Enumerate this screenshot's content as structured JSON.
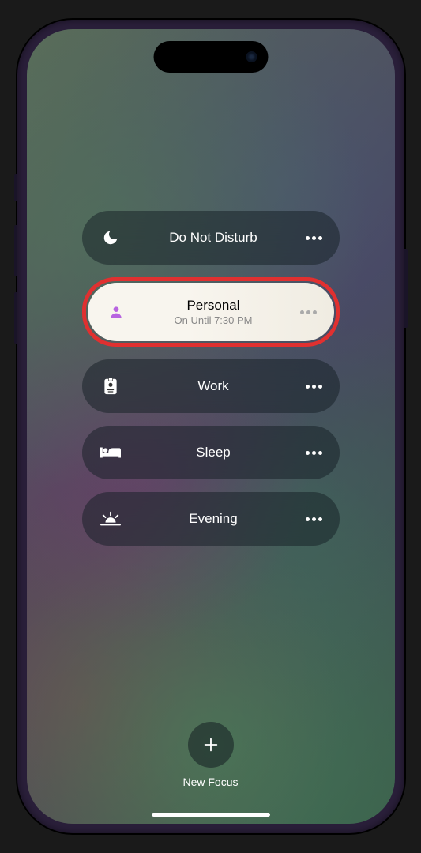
{
  "focus_modes": [
    {
      "id": "dnd",
      "label": "Do Not Disturb",
      "icon": "moon",
      "active": false
    },
    {
      "id": "personal",
      "label": "Personal",
      "sublabel": "On Until 7:30 PM",
      "icon": "person",
      "active": true,
      "icon_color": "#b864e0",
      "highlighted": true
    },
    {
      "id": "work",
      "label": "Work",
      "icon": "badge",
      "active": false
    },
    {
      "id": "sleep",
      "label": "Sleep",
      "icon": "bed",
      "active": false
    },
    {
      "id": "evening",
      "label": "Evening",
      "icon": "sunset",
      "active": false
    }
  ],
  "new_focus": {
    "label": "New Focus"
  }
}
